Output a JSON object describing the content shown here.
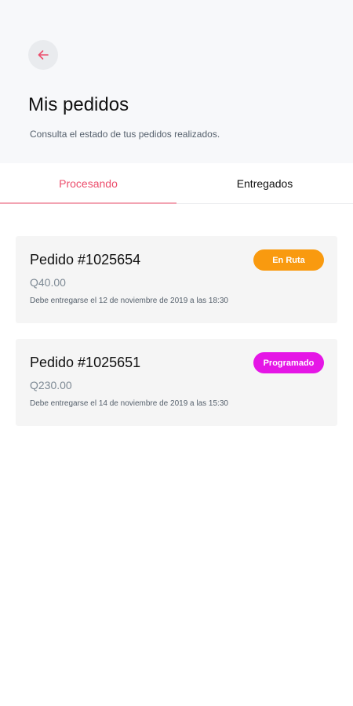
{
  "header": {
    "title": "Mis pedidos",
    "subtitle": "Consulta el estado de tus pedidos realizados.",
    "back_icon": "arrow-left-icon"
  },
  "tabs": [
    {
      "label": "Procesando",
      "active": true
    },
    {
      "label": "Entregados",
      "active": false
    }
  ],
  "colors": {
    "accent": "#ec4c6b",
    "en_ruta": "#f99a0f",
    "programado": "#e516e6"
  },
  "orders": [
    {
      "title": "Pedido #1025654",
      "amount": "Q40.00",
      "date": "Debe entregarse el 12 de noviembre de 2019 a las 18:30",
      "status": "En Ruta"
    },
    {
      "title": "Pedido #1025651",
      "amount": "Q230.00",
      "date": "Debe entregarse el 14 de noviembre de 2019 a las 15:30",
      "status": "Programado"
    }
  ]
}
